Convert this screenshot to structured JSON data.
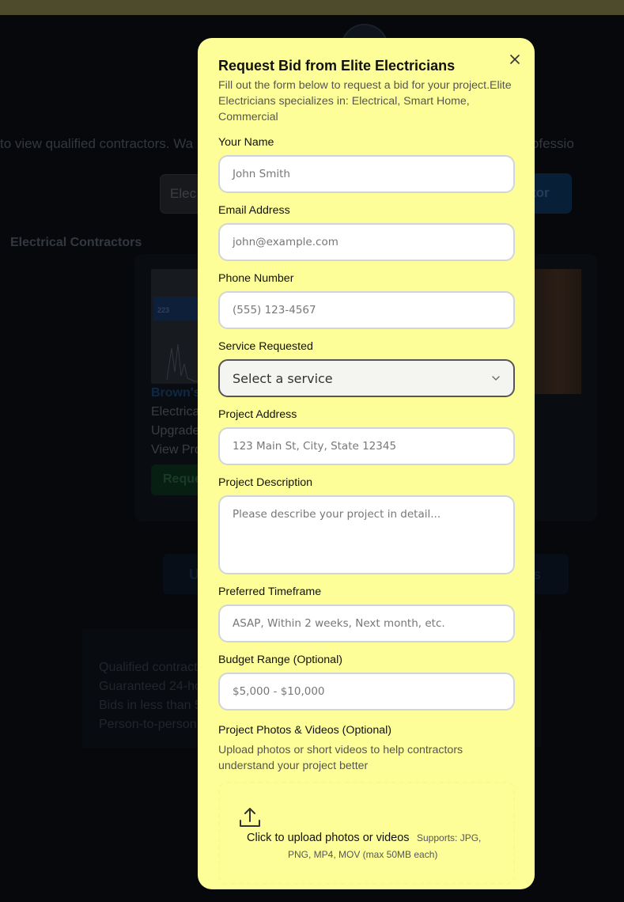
{
  "background": {
    "subtitle_left": "to view qualified contractors. Wa",
    "subtitle_right": "t the professio",
    "search_value": "Elec",
    "search_button_fragment": "tor",
    "section_title": "Electrical Contractors",
    "chart_thumb_value": "223",
    "card_name_fragment": "Brown's",
    "card_line1": "Electrica",
    "card_line2": "Upgrade",
    "card_line3": "View Pro",
    "card_button_fragment": "Reque",
    "pill_left": "U",
    "pill_right": "s",
    "benefits": [
      "Qualified contract",
      "Guaranteed 24-ho",
      "Bids in less than 5",
      "Person-to-person"
    ]
  },
  "modal": {
    "title": "Request Bid from Elite Electricians",
    "description": "Fill out the form below to request a bid for your project.Elite Electricians specializes in: Electrical, Smart Home, Commercial",
    "close_icon": "close-icon",
    "fields": {
      "name": {
        "label": "Your Name",
        "placeholder": "John Smith"
      },
      "email": {
        "label": "Email Address",
        "placeholder": "john@example.com"
      },
      "phone": {
        "label": "Phone Number",
        "placeholder": "(555) 123-4567"
      },
      "service": {
        "label": "Service Requested",
        "selected": "Select a service"
      },
      "address": {
        "label": "Project Address",
        "placeholder": "123 Main St, City, State 12345"
      },
      "description": {
        "label": "Project Description",
        "placeholder": "Please describe your project in detail..."
      },
      "timeframe": {
        "label": "Preferred Timeframe",
        "placeholder": "ASAP, Within 2 weeks, Next month, etc."
      },
      "budget": {
        "label": "Budget Range (Optional)",
        "placeholder": "$5,000 - $10,000"
      }
    },
    "upload": {
      "label": "Project Photos & Videos (Optional)",
      "note": "Upload photos or short videos to help contractors understand your project better",
      "main_text": "Click to upload photos or videos",
      "supports_line1": "Supports: JPG,",
      "supports_line2": "PNG, MP4, MOV (max 50MB each)",
      "icon": "upload-icon"
    }
  },
  "colors": {
    "modal_bg": "#fefe99",
    "page_bg": "#0c0f16",
    "input_border": "#d1d5db"
  }
}
